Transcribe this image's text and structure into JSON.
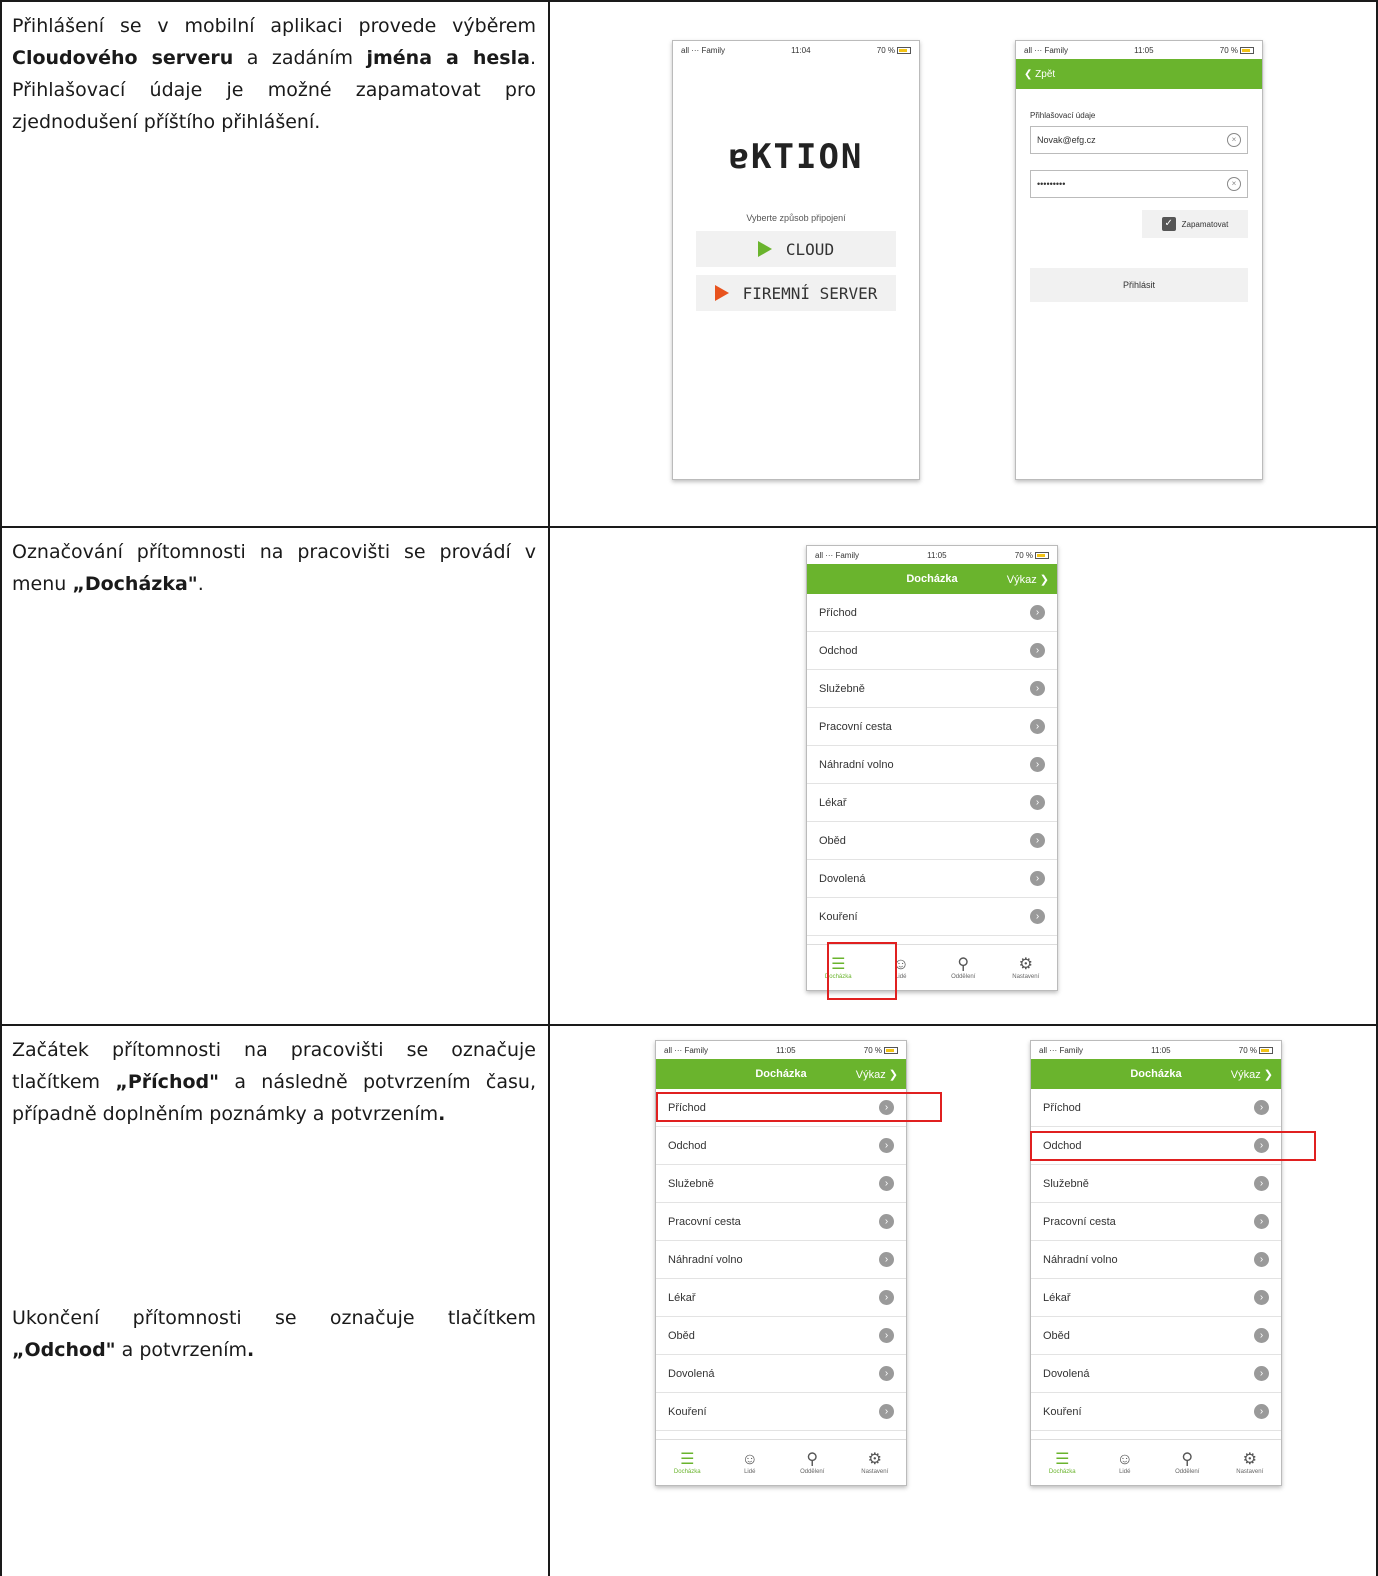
{
  "row1": {
    "p1": "Přihlášení se v mobilní aplikaci provede výběrem",
    "b1": "Cloudového serveru",
    "p2": "a zadáním",
    "b2": "jména a hesla",
    "p3": ". Přihlašovací údaje je možné zapamatovat pro zjednodušení příštího přihlášení."
  },
  "row2": {
    "p1": "Označování přítomnosti na pracovišti se provádí v menu",
    "b1": "„Docházka\"",
    "p2": "."
  },
  "row3": {
    "p1": "Začátek přítomnosti na pracovišti se označuje tlačítkem",
    "b1": "„Příchod\"",
    "p2": "a následně potvrzením času, případně doplněním poznámky a potvrzením",
    "p2b": ".",
    "p3": "Ukončení přítomnosti se označuje tlačítkem",
    "b2": "„Odchod\"",
    "p4": "a potvrzením",
    "p4b": "."
  },
  "status": {
    "carrier": "all ··· Family",
    "time1": "11:04",
    "time2": "11:05",
    "battery": "70 %"
  },
  "login1": {
    "logo": "ɐKTION",
    "choose": "Vyberte způsob připojení",
    "cloud": "CLOUD",
    "firm": "FIREMNÍ SERVER"
  },
  "login2": {
    "back": "Zpět",
    "label": "Přihlašovací údaje",
    "user": "Novak@efg.cz",
    "password": "•••••••••",
    "remember": "Zapamatovat",
    "login": "Přihlásit"
  },
  "attendance": {
    "title": "Docházka",
    "report": "Výkaz",
    "items": [
      "Příchod",
      "Odchod",
      "Služebně",
      "Pracovní cesta",
      "Náhradní volno",
      "Lékař",
      "Oběd",
      "Dovolená",
      "Kouření"
    ],
    "tabs": [
      "Docházka",
      "Lidé",
      "Oddělení",
      "Nastavení"
    ]
  }
}
